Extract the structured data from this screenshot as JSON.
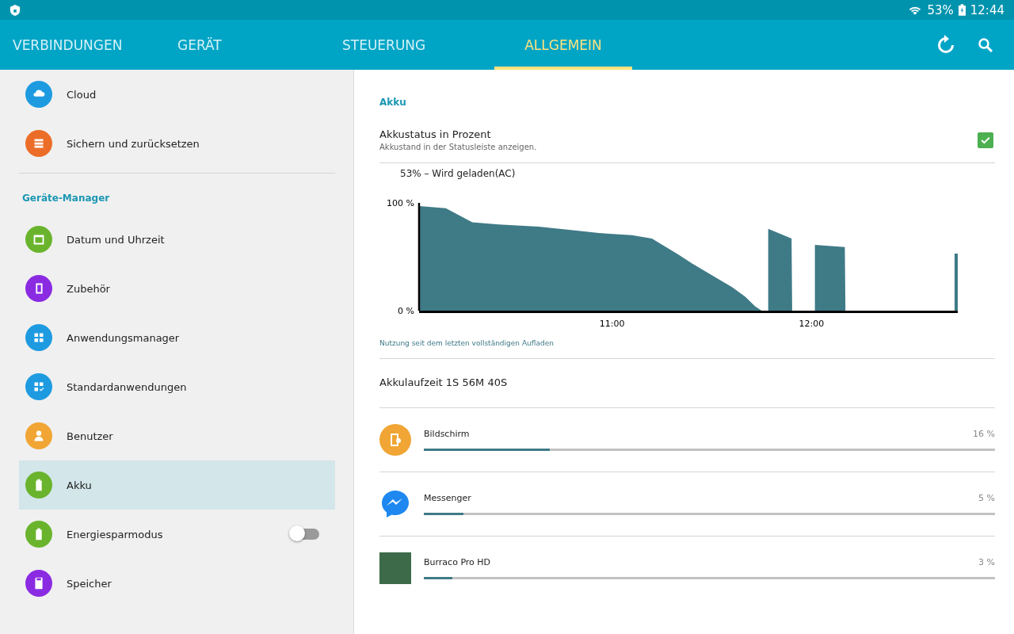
{
  "status_bar": {
    "battery": "53%",
    "time": "12:44"
  },
  "tabs": [
    {
      "label": "VERBINDUNGEN",
      "selected": false
    },
    {
      "label": "GERÄT",
      "selected": false
    },
    {
      "label": "STEUERUNG",
      "selected": false
    },
    {
      "label": "ALLGEMEIN",
      "selected": true
    }
  ],
  "sidebar": {
    "sections": [
      {
        "items": [
          {
            "label": "Cloud",
            "color": "#1e9be0",
            "kind": "link",
            "selected": false
          },
          {
            "label": "Sichern und zurücksetzen",
            "color": "#ec6d27",
            "kind": "link",
            "selected": false
          }
        ]
      },
      {
        "header": "Geräte-Manager",
        "items": [
          {
            "label": "Datum und Uhrzeit",
            "color": "#6ab42d",
            "kind": "link",
            "selected": false
          },
          {
            "label": "Zubehör",
            "color": "#8a2be2",
            "kind": "link",
            "selected": false
          },
          {
            "label": "Anwendungsmanager",
            "color": "#1e9be0",
            "kind": "link",
            "selected": false
          },
          {
            "label": "Standardanwendungen",
            "color": "#1e9be0",
            "kind": "link",
            "selected": false
          },
          {
            "label": "Benutzer",
            "color": "#f0a534",
            "kind": "link",
            "selected": false
          },
          {
            "label": "Akku",
            "color": "#6ab42d",
            "kind": "link",
            "selected": true
          },
          {
            "label": "Energiesparmodus",
            "color": "#6ab42d",
            "kind": "toggle",
            "on": false,
            "selected": false
          },
          {
            "label": "Speicher",
            "color": "#8a2be2",
            "kind": "link",
            "selected": false
          }
        ]
      }
    ]
  },
  "detail": {
    "section_title": "Akku",
    "percent_setting": {
      "title": "Akkustatus in Prozent",
      "subtitle": "Akkustand in der Statusleiste anzeigen.",
      "checked": true
    },
    "chart_title": "53% – Wird geladen(AC)",
    "chart_data": {
      "type": "area",
      "x": [
        10.033,
        10.167,
        10.3,
        10.433,
        10.633,
        10.833,
        10.933,
        11.1,
        11.2,
        11.333,
        11.4,
        11.517,
        11.6,
        11.667,
        11.717,
        11.75,
        11.758,
        11.783,
        11.9,
        11.903,
        12.017,
        12.167,
        12.17,
        12.717,
        12.733
      ],
      "series": [
        {
          "color": "#3f7a87",
          "values": [
            97,
            95,
            82,
            80,
            78,
            74,
            72,
            70,
            67,
            52,
            44,
            31,
            22,
            13,
            4,
            0,
            null,
            76,
            67,
            null,
            61,
            59,
            null,
            53,
            53
          ]
        }
      ],
      "xlim": [
        10.033,
        12.733
      ],
      "ylim": [
        0,
        100
      ],
      "xticks": [
        {
          "value": 11,
          "label": "11:00"
        },
        {
          "value": 12,
          "label": "12:00"
        }
      ],
      "yticks": [
        {
          "value": 0,
          "label": "0 %"
        },
        {
          "value": 100,
          "label": "100 %"
        }
      ]
    },
    "chart_caption": "Nutzung seit dem letzten vollständigen Aufladen",
    "runtime": "Akkulaufzeit 1S 56M 40S",
    "usage": [
      {
        "name": "Bildschirm",
        "percent": "16 %",
        "level": 0.22
      },
      {
        "name": "Messenger",
        "percent": "5 %",
        "level": 0.07
      },
      {
        "name": "Burraco Pro HD",
        "percent": "3 %",
        "level": 0.05
      }
    ]
  }
}
